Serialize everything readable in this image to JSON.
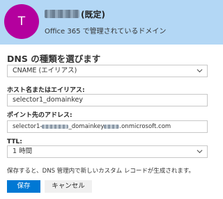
{
  "header": {
    "avatar_letter": "T",
    "domain_suffix": "(既定)",
    "description": "Office 365 で管理されているドメイン"
  },
  "form": {
    "section_title": "DNS の種類を選びます",
    "dns_type": {
      "selected": "CNAME (エイリアス)"
    },
    "host_label": "ホスト名またはエイリアス:",
    "host_value": "selector1_domainkey",
    "target_label": "ポイント先のアドレス:",
    "target_parts": {
      "prefix": "selector1-",
      "middle": "_domainkey",
      "suffix": ".onmicrosoft.com"
    },
    "ttl_label": "TTL:",
    "ttl": {
      "selected": "1 時間"
    },
    "info_text": "保存すると、DNS 管理内で新しいカスタム レコードが生成されます。"
  },
  "buttons": {
    "save": "保存",
    "cancel": "キャンセル"
  },
  "colors": {
    "header_bg": "#b3d7f5",
    "avatar_bg": "#b4009e",
    "primary": "#0078d4"
  },
  "icons": {
    "dropdown": "chevron-down-icon"
  }
}
